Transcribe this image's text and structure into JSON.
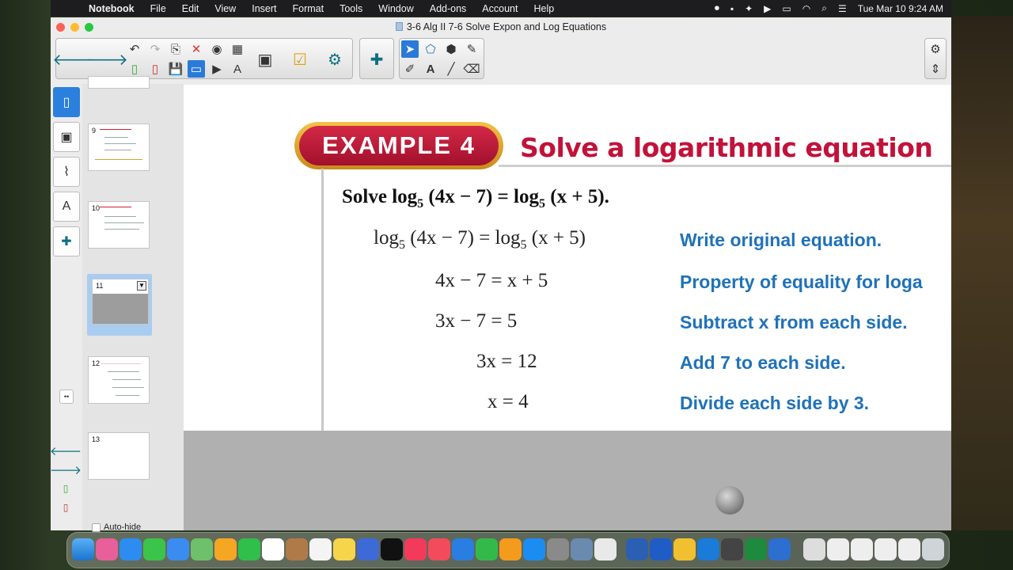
{
  "menubar": {
    "app_name": "Notebook",
    "items": [
      "File",
      "Edit",
      "View",
      "Insert",
      "Format",
      "Tools",
      "Window",
      "Add-ons",
      "Account",
      "Help"
    ],
    "clock": "Tue Mar 10  9:24 AM"
  },
  "window": {
    "title": "3-6 Alg II 7-6 Solve Expon and Log Equations"
  },
  "sidebar": {
    "pages": [
      "9",
      "10",
      "11",
      "12",
      "13"
    ],
    "selected_page": "11",
    "autohide_label": "Auto-hide"
  },
  "slide": {
    "badge": "EXAMPLE 4",
    "title": "Solve a logarithmic equation",
    "problem_prefix": "Solve log",
    "problem_base": "5",
    "problem_mid": " (4x − 7) = log",
    "problem_base2": "5",
    "problem_end": " (x + 5).",
    "steps": [
      {
        "lhs": "log",
        "base": "5",
        "lhs2": " (4x − 7) = log",
        "base2": "5",
        "rhs": " (x + 5)",
        "reason": "Write original equation."
      },
      {
        "expr": "4x − 7 = x + 5",
        "reason": "Property of equality for loga"
      },
      {
        "expr": "3x − 7 = 5",
        "reason": "Subtract x from each side."
      },
      {
        "expr": "3x = 12",
        "reason": "Add 7 to each side."
      },
      {
        "expr": "x = 4",
        "reason": "Divide each side by 3."
      }
    ]
  },
  "colors": {
    "badge_red": "#c2123a",
    "reason_blue": "#1f72b8",
    "selection_blue": "#2c80dd"
  }
}
